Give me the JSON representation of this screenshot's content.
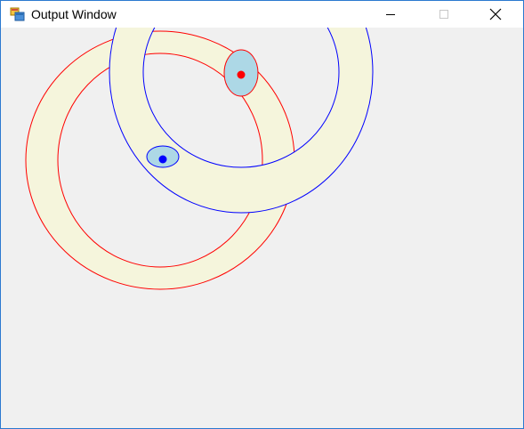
{
  "window": {
    "title": "Output Window",
    "icon": "app-window-icon"
  },
  "caption_buttons": {
    "minimize_icon": "minimize-icon",
    "maximize_icon": "maximize-icon",
    "close_icon": "close-icon"
  },
  "colors": {
    "window_border": "#2b79d0",
    "client_background": "#f0f0f0",
    "ring_fill": "#f5f5dc",
    "red_outline": "#ff0000",
    "blue_outline": "#0000ff",
    "marker_fill": "#add8e6",
    "red_dot": "#ff0000",
    "blue_dot": "#0000ff"
  }
}
